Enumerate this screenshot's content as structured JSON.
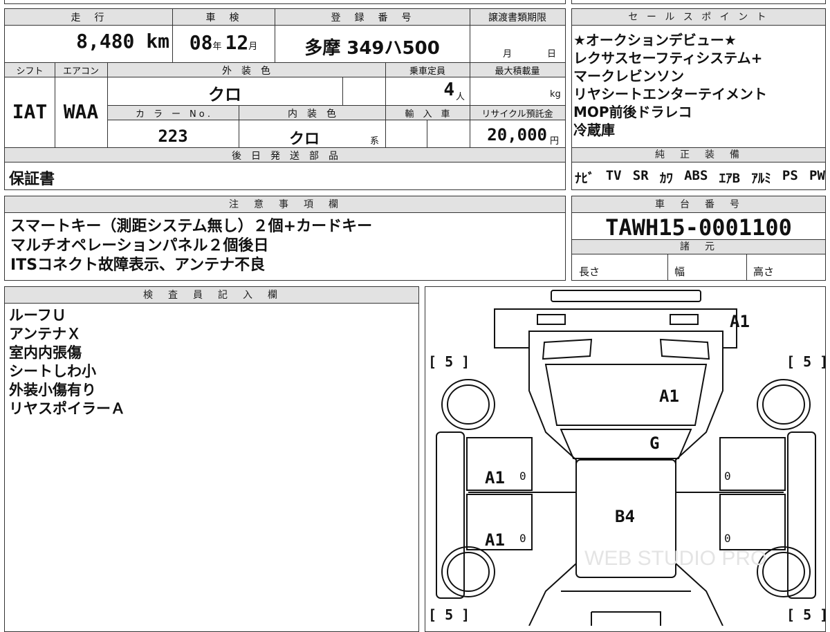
{
  "basic": {
    "h_mileage": "走　行",
    "h_inspection": "車　検",
    "h_reg": "登　録　番　号",
    "h_transfer": "譲渡書類期限",
    "mileage": "8,480",
    "mileage_unit": "km",
    "insp_year": "08",
    "insp_year_unit": "年",
    "insp_month": "12",
    "insp_month_unit": "月",
    "reg_number": "多摩 349ハ500",
    "transfer_month": "月",
    "transfer_day": "日",
    "h_shift": "シフト",
    "h_ac": "エアコン",
    "h_ext_color": "外　装　色",
    "h_capacity": "乗車定員",
    "h_max_load": "最大積載量",
    "shift": "IAT",
    "ac": "WAA",
    "ext_color": "クロ",
    "capacity": "4",
    "capacity_unit": "人",
    "max_load_unit": "kg",
    "h_color_no": "カ　ラ　ー　N o .",
    "h_int_color": "内　装　色",
    "h_import": "輸　入　車",
    "h_recycle": "リサイクル預託金",
    "color_no": "223",
    "int_color": "クロ",
    "int_color_suffix": "系",
    "recycle": "20,000",
    "recycle_unit": "円",
    "h_later_parts": "後　日　発　送　部　品",
    "later_parts": "保証書"
  },
  "sales": {
    "header": "セ ー ル ス ポ イ ン ト",
    "lines": [
      "★オークションデビュー★",
      "レクサスセーフティシステム+",
      "マークレビンソン",
      "リヤシートエンターテイメント",
      "MOP前後ドラレコ",
      "冷蔵庫"
    ]
  },
  "equipment": {
    "header": "純　正　装　備",
    "items": [
      "ﾅﾋﾞ",
      "TV",
      "SR",
      "ｶﾜ",
      "ABS",
      "ｴｱB",
      "ｱﾙﾐ",
      "PS",
      "PW"
    ]
  },
  "notes": {
    "header": "注　意　事　項　欄",
    "lines": [
      "スマートキー（測距システム無し）２個+カードキー",
      "マルチオペレーションパネル２個後日",
      "ITSコネクト故障表示、アンテナ不良"
    ]
  },
  "chassis": {
    "header": "車　台　番　号",
    "number": "TAWH15-0001100",
    "spec_header": "諸　元",
    "length": "長さ",
    "width": "幅",
    "height": "高さ"
  },
  "inspector": {
    "header": "検　査　員　記　入　欄",
    "lines": [
      "ルーフＵ",
      "アンテナＸ",
      "室内内張傷",
      "シートしわ小",
      "外装小傷有り",
      "リヤスポイラーＡ"
    ]
  },
  "diagram": {
    "marks": {
      "front_bumper": "A1",
      "hood": "A1",
      "windshield": "G",
      "roof": "B4",
      "left_front_door": "A1",
      "left_rear_door": "A1",
      "zero1": "0",
      "zero2": "0",
      "zero3": "0",
      "zero4": "0"
    },
    "tire_tl": "[ 5 ]",
    "tire_tr": "[ 5 ]",
    "tire_bl": "[ 5 ]",
    "tire_br": "[ 5 ]",
    "watermark": "WEB STUDIO PRO"
  },
  "colors": {
    "header_bg": "#e2e2e2",
    "border": "#333333"
  }
}
